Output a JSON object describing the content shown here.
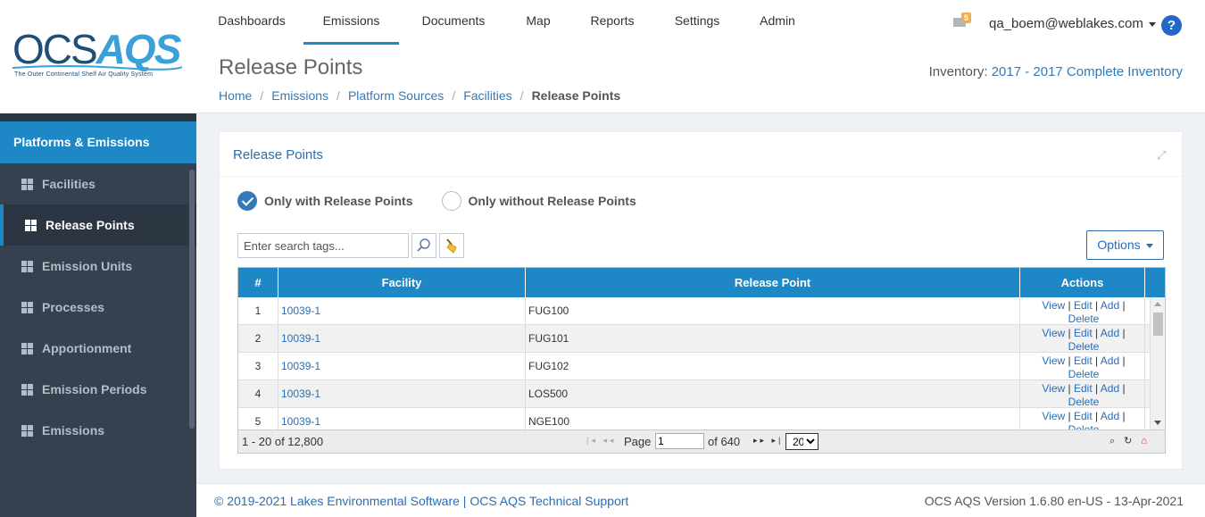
{
  "logo": {
    "brand_a": "OCS",
    "brand_b": "AQS",
    "tagline": "The Outer Continental Shelf Air Quality System"
  },
  "sidebar": {
    "header": "Platforms & Emissions",
    "items": [
      {
        "label": "Facilities",
        "active": false
      },
      {
        "label": "Release Points",
        "active": true
      },
      {
        "label": "Emission Units",
        "active": false
      },
      {
        "label": "Processes",
        "active": false
      },
      {
        "label": "Apportionment",
        "active": false
      },
      {
        "label": "Emission Periods",
        "active": false
      },
      {
        "label": "Emissions",
        "active": false
      }
    ]
  },
  "topnav": {
    "items": [
      "Dashboards",
      "Emissions",
      "Documents",
      "Map",
      "Reports",
      "Settings",
      "Admin"
    ],
    "active": "Emissions",
    "mail_count": "5",
    "user": "qa_boem@weblakes.com",
    "help": "?"
  },
  "page": {
    "title": "Release Points",
    "inventory_label": "Inventory:",
    "inventory_value": "2017 - 2017 Complete Inventory",
    "breadcrumb": [
      "Home",
      "Emissions",
      "Platform Sources",
      "Facilities",
      "Release Points"
    ]
  },
  "portlet": {
    "title": "Release Points",
    "radio_with": "Only with Release Points",
    "radio_without": "Only without Release Points",
    "search_placeholder": "Enter search tags...",
    "options_label": "Options"
  },
  "table": {
    "columns": [
      "#",
      "Facility",
      "Release Point",
      "Actions"
    ],
    "rows": [
      {
        "num": "1",
        "facility": "10039-1",
        "release_point": "FUG100"
      },
      {
        "num": "2",
        "facility": "10039-1",
        "release_point": "FUG101"
      },
      {
        "num": "3",
        "facility": "10039-1",
        "release_point": "FUG102"
      },
      {
        "num": "4",
        "facility": "10039-1",
        "release_point": "LOS500"
      },
      {
        "num": "5",
        "facility": "10039-1",
        "release_point": "NGE100"
      }
    ],
    "actions": {
      "view": "View",
      "edit": "Edit",
      "add": "Add",
      "delete": "Delete",
      "sep": "|"
    },
    "pager": {
      "range": "1 - 20 of 12,800",
      "page_label": "Page",
      "page_value": "1",
      "of_pages": "of 640",
      "page_size": "20"
    }
  },
  "footer": {
    "left": "© 2019-2021 Lakes Environmental Software | OCS AQS Technical Support",
    "right": "OCS AQS Version 1.6.80 en-US - 13-Apr-2021"
  }
}
